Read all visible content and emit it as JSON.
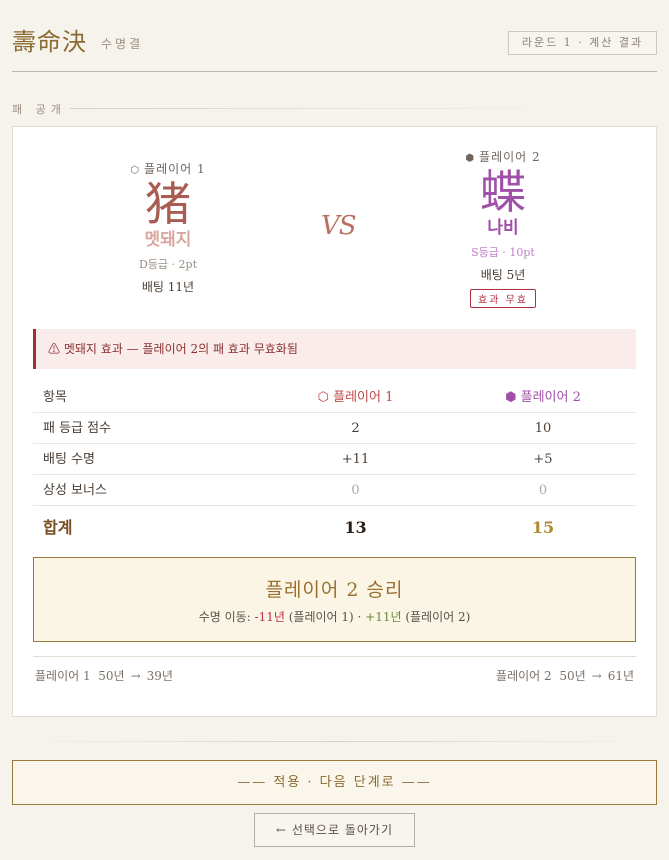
{
  "header": {
    "logo": "壽命決",
    "logo_sub": "수명결",
    "round_badge": "라운드 1 · 계산 결과"
  },
  "section": {
    "label": "패 공개"
  },
  "player1": {
    "name": "플레이어 1",
    "icon": "hollow-hexagon-icon",
    "kanji": "猪",
    "card_name": "멧돼지",
    "grade": "D등급 · 2pt",
    "bet": "배팅 11년"
  },
  "player2": {
    "name": "플레이어 2",
    "icon": "filled-hexagon-icon",
    "kanji": "蝶",
    "card_name": "나비",
    "grade": "S등급 · 10pt",
    "bet": "배팅 5년",
    "badge": "효과 무효"
  },
  "vs": "VS",
  "alert": {
    "icon": "⚠",
    "text": "멧돼지 효과 — 플레이어 2의 패 효과 무효화됨"
  },
  "table": {
    "headers": {
      "label": "항목",
      "p1": "플레이어 1",
      "p2": "플레이어 2"
    },
    "rows": [
      {
        "label": "패 등급 점수",
        "p1": "2",
        "p2": "10"
      },
      {
        "label": "배팅 수명",
        "p1": "+11",
        "p2": "+5"
      },
      {
        "label": "상성 보너스",
        "p1": "0",
        "p2": "0"
      }
    ],
    "total": {
      "label": "합계",
      "p1": "13",
      "p2": "15"
    }
  },
  "result": {
    "title": "플레이어 2 승리",
    "desc_prefix": "수명 이동: ",
    "p1_delta": "-11년",
    "p1_tag": " (플레이어 1) · ",
    "p2_delta": "+11년",
    "p2_tag": " (플레이어 2)"
  },
  "lifespan": {
    "p1": {
      "name": "플레이어 1",
      "from": "50년",
      "arrow": "→",
      "to": "39년"
    },
    "p2": {
      "name": "플레이어 2",
      "from": "50년",
      "arrow": "→",
      "to": "61년"
    }
  },
  "buttons": {
    "apply": "—— 적용 · 다음 단계로 ——",
    "back": "← 선택으로 돌아가기"
  },
  "colors": {
    "gold_accent": "#8a6a2f",
    "p1_color": "#c04848",
    "p2_color": "#a050a8",
    "alert_bg": "#fbecec"
  }
}
